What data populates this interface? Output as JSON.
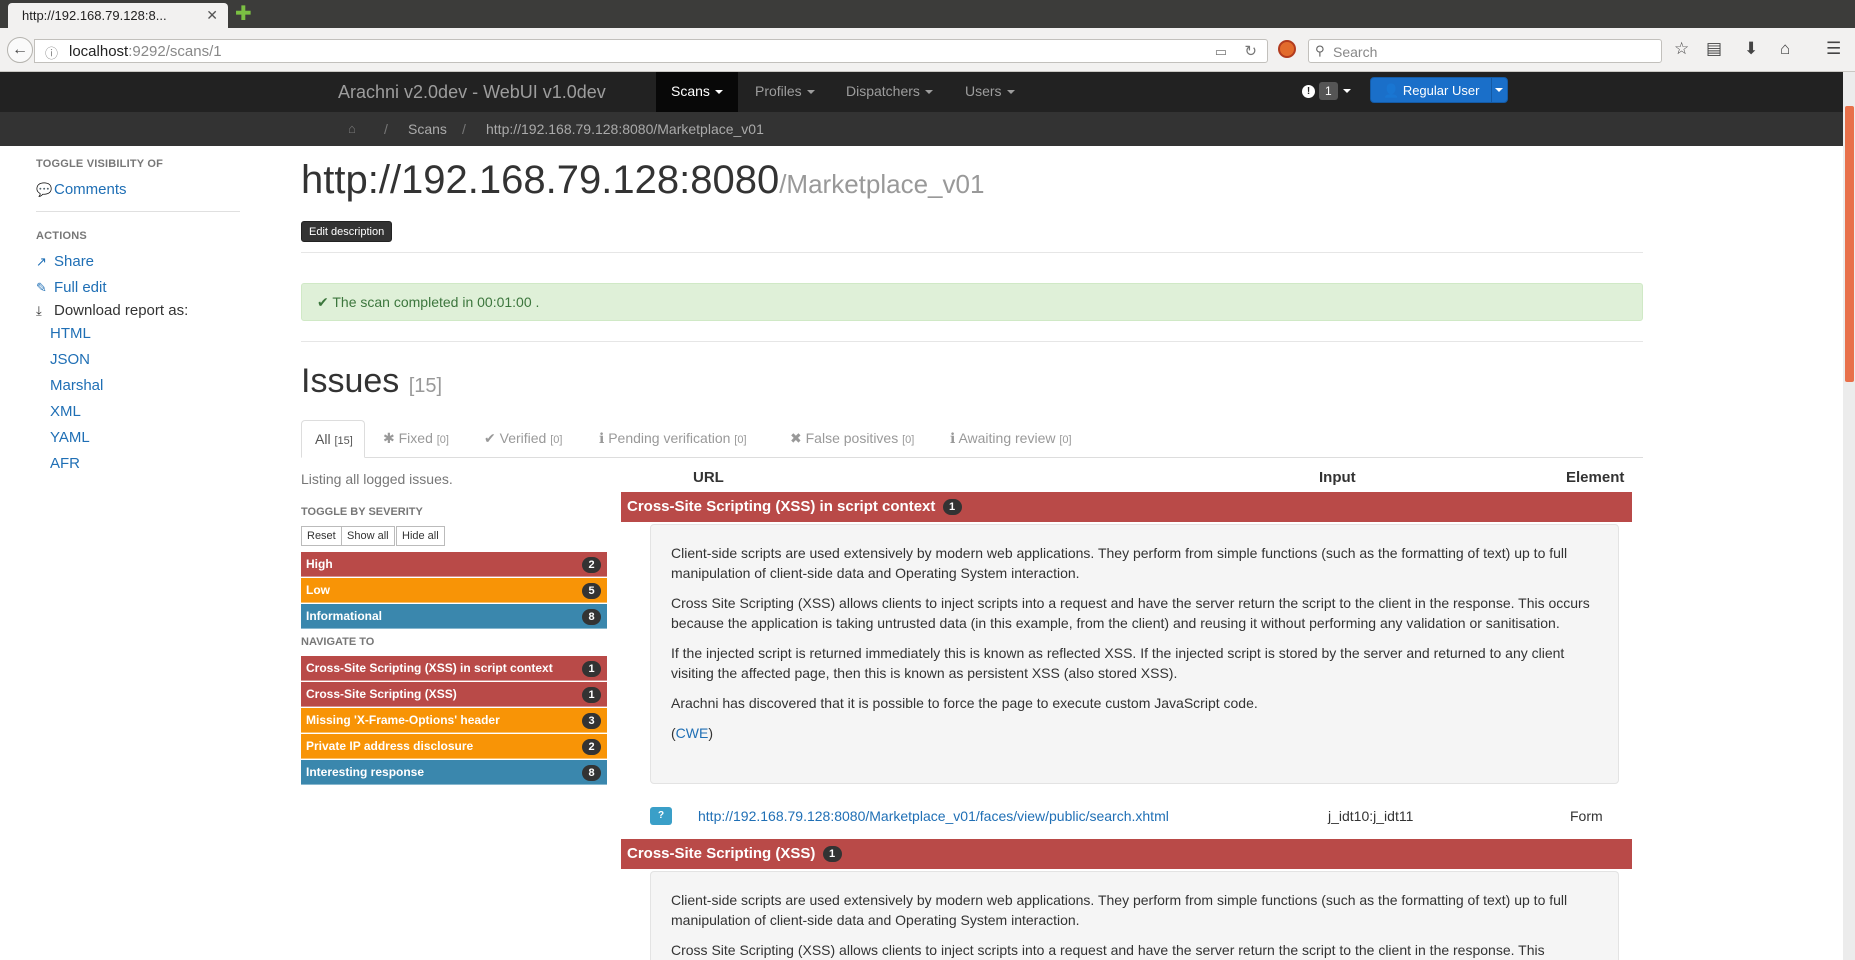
{
  "browser": {
    "tab_title": "http://192.168.79.128:8...",
    "tab_close": "✕",
    "new_tab": "✚",
    "url_host": "localhost",
    "url_rest": ":9292/scans/1",
    "search_placeholder": "Search"
  },
  "app": {
    "brand": "Arachni v2.0dev - WebUI v1.0dev",
    "menu": [
      {
        "label": "Scans"
      },
      {
        "label": "Profiles"
      },
      {
        "label": "Dispatchers"
      },
      {
        "label": "Users"
      }
    ],
    "notification_count": "1",
    "user_button": "Regular User"
  },
  "breadcrumb": {
    "sep": "/",
    "scans": "Scans",
    "url": "http://192.168.79.128:8080/Marketplace_v01"
  },
  "sidebar": {
    "toggle_head": "TOGGLE VISIBILITY OF",
    "comments": "Comments",
    "actions_head": "ACTIONS",
    "share": "Share",
    "full_edit": "Full edit",
    "download_label": "Download report as:",
    "formats": [
      "HTML",
      "JSON",
      "Marshal",
      "XML",
      "YAML",
      "AFR"
    ]
  },
  "scan": {
    "title_host": "http://192.168.79.128:8080",
    "title_path": "/Marketplace_v01",
    "edit_description": "Edit description",
    "completed_prefix": "The scan completed in",
    "duration": "00:01:00",
    "completed_suffix": "."
  },
  "issues": {
    "title": "Issues",
    "count": "[15]",
    "tabs": [
      {
        "label": "All",
        "count": "[15]"
      },
      {
        "label": "Fixed",
        "count": "[0]"
      },
      {
        "label": "Verified",
        "count": "[0]"
      },
      {
        "label": "Pending verification",
        "count": "[0]"
      },
      {
        "label": "False positives",
        "count": "[0]"
      },
      {
        "label": "Awaiting review",
        "count": "[0]"
      }
    ],
    "listing": "Listing all logged issues.",
    "toggle_severity": "TOGGLE BY SEVERITY",
    "buttons": {
      "reset": "Reset",
      "show_all": "Show all",
      "hide_all": "Hide all"
    },
    "severities": [
      {
        "label": "High",
        "count": "2"
      },
      {
        "label": "Low",
        "count": "5"
      },
      {
        "label": "Informational",
        "count": "8"
      }
    ],
    "navigate_to": "NAVIGATE TO",
    "nav_items": [
      {
        "label": "Cross-Site Scripting (XSS) in script context",
        "count": "1"
      },
      {
        "label": "Cross-Site Scripting (XSS)",
        "count": "1"
      },
      {
        "label": "Missing 'X-Frame-Options' header",
        "count": "3"
      },
      {
        "label": "Private IP address disclosure",
        "count": "2"
      },
      {
        "label": "Interesting response",
        "count": "8"
      }
    ],
    "columns": {
      "url": "URL",
      "input": "Input",
      "element": "Element"
    },
    "groups": [
      {
        "title": "Cross-Site Scripting (XSS) in script context",
        "count": "1",
        "p1": "Client-side scripts are used extensively by modern web applications. They perform from simple functions (such as the formatting of text) up to full manipulation of client-side data and Operating System interaction.",
        "p2": "Cross Site Scripting (XSS) allows clients to inject scripts into a request and have the server return the script to the client in the response. This occurs because the application is taking untrusted data (in this example, from the client) and reusing it without performing any validation or sanitisation.",
        "p3": "If the injected script is returned immediately this is known as reflected XSS. If the injected script is stored by the server and returned to any client visiting the affected page, then this is known as persistent XSS (also stored XSS).",
        "p4": "Arachni has discovered that it is possible to force the page to execute custom JavaScript code.",
        "cwe": "CWE",
        "issue_url": "http://192.168.79.128:8080/Marketplace_v01/faces/view/public/search.xhtml",
        "issue_input": "j_idt10:j_idt11",
        "issue_element": "Form"
      },
      {
        "title": "Cross-Site Scripting (XSS)",
        "count": "1",
        "p1": "Client-side scripts are used extensively by modern web applications. They perform from simple functions (such as the formatting of text) up to full manipulation of client-side data and Operating System interaction.",
        "p2": "Cross Site Scripting (XSS) allows clients to inject scripts into a request and have the server return the script to the client in the response. This"
      }
    ]
  },
  "colors": {
    "high": "#b94a48",
    "low": "#f89406",
    "informational": "#3a87ad",
    "link": "#1f6fb5",
    "success_bg": "#dff0d8"
  }
}
